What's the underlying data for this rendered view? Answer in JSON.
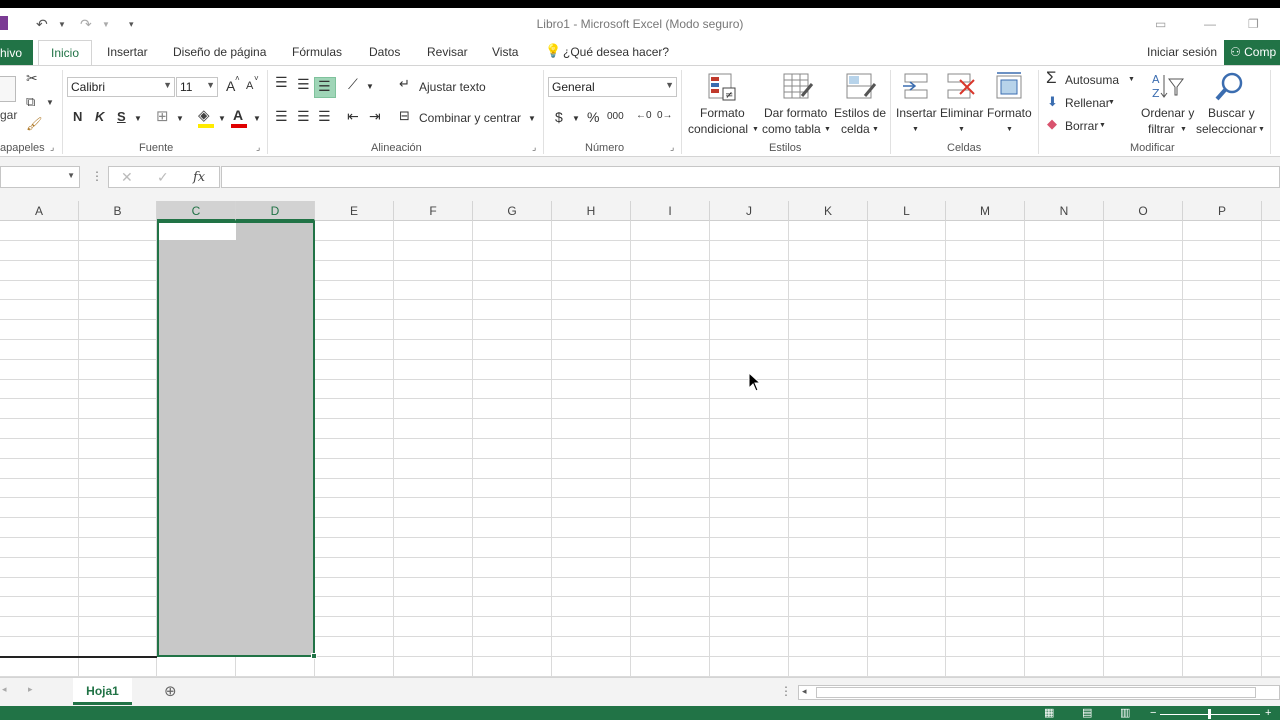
{
  "window": {
    "title": "Libro1 - Microsoft Excel (Modo seguro)"
  },
  "tabs": {
    "file": "hivo",
    "home": "Inicio",
    "insert": "Insertar",
    "page_layout": "Diseño de página",
    "formulas": "Fórmulas",
    "data": "Datos",
    "review": "Revisar",
    "view": "Vista",
    "tell_me": "¿Qué desea hacer?",
    "sign_in": "Iniciar sesión",
    "share": "Comp"
  },
  "ribbon": {
    "clipboard": {
      "label": "apapeles",
      "paste_partial": "gar"
    },
    "font": {
      "label": "Fuente",
      "font_name": "Calibri",
      "font_size": "11",
      "bold": "N",
      "italic": "K",
      "underline": "S",
      "grow": "A",
      "shrink": "A"
    },
    "alignment": {
      "label": "Alineación",
      "wrap_text": "Ajustar texto",
      "merge_center": "Combinar y centrar"
    },
    "number": {
      "label": "Número",
      "format": "General",
      "currency": "$",
      "percent": "%",
      "thousands": "000"
    },
    "styles": {
      "label": "Estilos",
      "conditional_1": "Formato",
      "conditional_2": "condicional",
      "table_1": "Dar formato",
      "table_2": "como tabla",
      "cell_styles_1": "Estilos de",
      "cell_styles_2": "celda"
    },
    "cells": {
      "label": "Celdas",
      "insert": "Insertar",
      "delete": "Eliminar",
      "format": "Formato"
    },
    "editing": {
      "label": "Modificar",
      "autosum": "Autosuma",
      "fill": "Rellenar",
      "clear": "Borrar",
      "sort_1": "Ordenar y",
      "sort_2": "filtrar",
      "find_1": "Buscar y",
      "find_2": "seleccionar"
    }
  },
  "formula_bar": {
    "fx": "fx",
    "value": ""
  },
  "columns": [
    "A",
    "B",
    "C",
    "D",
    "E",
    "F",
    "G",
    "H",
    "I",
    "J",
    "K",
    "L",
    "M",
    "N",
    "O",
    "P"
  ],
  "selected_columns": [
    "C",
    "D"
  ],
  "sheets": {
    "active": "Hoja1"
  },
  "colors": {
    "accent": "#217346",
    "selection": "#c8c8c8"
  }
}
